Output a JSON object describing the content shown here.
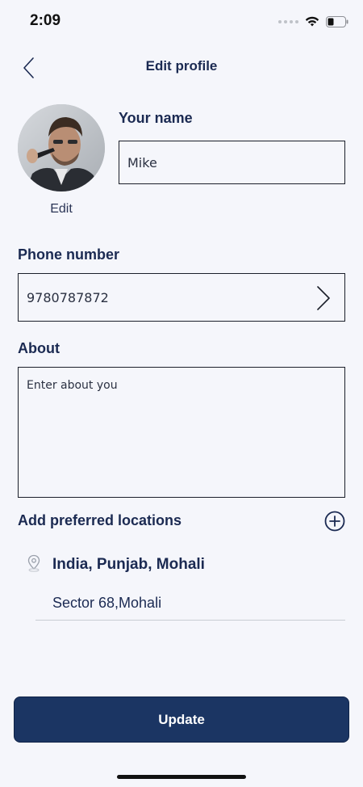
{
  "status_bar": {
    "time": "2:09"
  },
  "header": {
    "title": "Edit profile"
  },
  "avatar": {
    "edit_label": "Edit"
  },
  "name_field": {
    "label": "Your name",
    "value": "Mike"
  },
  "phone_field": {
    "label": "Phone number",
    "value": "9780787872"
  },
  "about_field": {
    "label": "About",
    "placeholder": "Enter about you"
  },
  "locations": {
    "label": "Add preferred locations",
    "items": [
      {
        "title": "India, Punjab, Mohali",
        "subtitle": "Sector 68,Mohali"
      }
    ]
  },
  "update_button": {
    "label": "Update"
  },
  "colors": {
    "primary": "#1b3563",
    "text": "#1b2a52",
    "background": "#f5f6fb"
  },
  "icons": [
    "back-chevron-icon",
    "chevron-right-icon",
    "add-circle-icon",
    "location-pin-icon",
    "wifi-icon",
    "battery-icon"
  ]
}
